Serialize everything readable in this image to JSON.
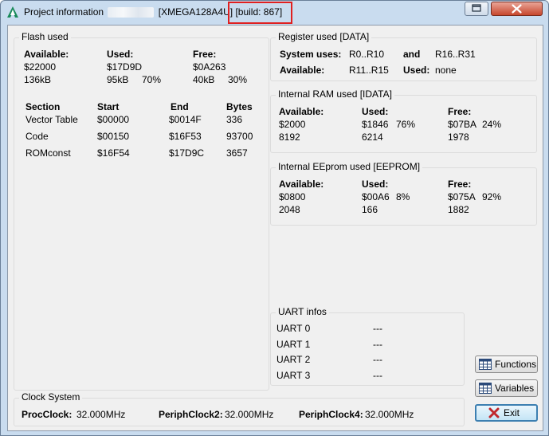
{
  "titlebar": {
    "prefix": "Project information",
    "mid": "[XMEGA128A4U]",
    "build": "[build: 867]"
  },
  "flash": {
    "title": "Flash used",
    "available_label": "Available:",
    "used_label": "Used:",
    "free_label": "Free:",
    "available_hex": "$22000",
    "available_kb": "136kB",
    "used_hex": "$17D9D",
    "used_kb": "95kB",
    "used_pct": "70%",
    "free_hex": "$0A263",
    "free_kb": "40kB",
    "free_pct": "30%",
    "headers": [
      "Section",
      "Start",
      "End",
      "Bytes"
    ],
    "rows": [
      [
        "Vector Table",
        "$00000",
        "$0014F",
        "336"
      ],
      [
        "Code",
        "$00150",
        "$16F53",
        "93700"
      ],
      [
        "ROMconst",
        "$16F54",
        "$17D9C",
        "3657"
      ]
    ]
  },
  "registers": {
    "title": "Register used [DATA]",
    "system_uses_label": "System uses:",
    "system_uses_from": "R0..R10",
    "and_label": "and",
    "system_uses_to": "R16..R31",
    "available_label": "Available:",
    "available_value": "R11..R15",
    "used_label": "Used:",
    "used_value": "none"
  },
  "ram": {
    "title": "Internal RAM used [IDATA]",
    "available_label": "Available:",
    "used_label": "Used:",
    "free_label": "Free:",
    "available_hex": "$2000",
    "available_dec": "8192",
    "used_hex": "$1846",
    "used_pct": "76%",
    "used_dec": "6214",
    "free_hex": "$07BA",
    "free_pct": "24%",
    "free_dec": "1978"
  },
  "eeprom": {
    "title": "Internal EEprom used [EEPROM]",
    "available_label": "Available:",
    "used_label": "Used:",
    "free_label": "Free:",
    "available_hex": "$0800",
    "available_dec": "2048",
    "used_hex": "$00A6",
    "used_pct": "8%",
    "used_dec": "166",
    "free_hex": "$075A",
    "free_pct": "92%",
    "free_dec": "1882"
  },
  "uart": {
    "title": "UART infos",
    "rows": [
      {
        "name": "UART 0",
        "value": "---"
      },
      {
        "name": "UART 1",
        "value": "---"
      },
      {
        "name": "UART 2",
        "value": "---"
      },
      {
        "name": "UART 3",
        "value": "---"
      }
    ]
  },
  "clock": {
    "title": "Clock System",
    "proc_label": "ProcClock:",
    "proc_value": "32.000MHz",
    "periph2_label": "PeriphClock2:",
    "periph2_value": "32.000MHz",
    "periph4_label": "PeriphClock4:",
    "periph4_value": "32.000MHz"
  },
  "buttons": {
    "functions": "Functions",
    "variables": "Variables",
    "exit": "Exit"
  },
  "colors": {
    "highlight": "#e02020",
    "exit_icon": "#c0272d",
    "app_icon": "#1a8a5a"
  }
}
